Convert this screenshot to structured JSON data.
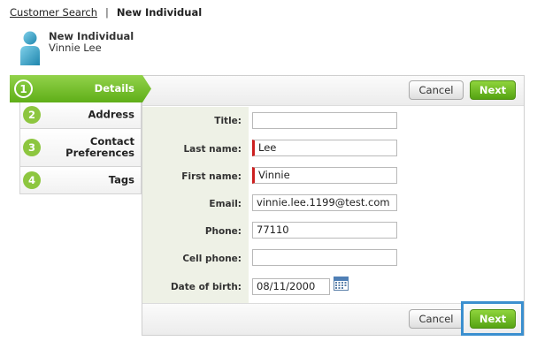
{
  "breadcrumb": {
    "link": "Customer Search",
    "separator": "|",
    "current": "New Individual"
  },
  "header": {
    "record_type": "New Individual",
    "name": "Vinnie Lee",
    "icon": "person-icon"
  },
  "steps": [
    {
      "number": "1",
      "label": "Details",
      "active": true
    },
    {
      "number": "2",
      "label": "Address",
      "active": false
    },
    {
      "number": "3",
      "label": "Contact\nPreferences",
      "active": false
    },
    {
      "number": "4",
      "label": "Tags",
      "active": false
    }
  ],
  "toolbar": {
    "cancel_label": "Cancel",
    "next_label": "Next"
  },
  "form": {
    "title_label": "Title:",
    "title_value": "",
    "last_name_label": "Last name:",
    "last_name_value": "Lee",
    "first_name_label": "First name:",
    "first_name_value": "Vinnie",
    "email_label": "Email:",
    "email_value": "vinnie.lee.1199@test.com",
    "phone_label": "Phone:",
    "phone_value": "77110",
    "cell_label": "Cell phone:",
    "cell_value": "",
    "dob_label": "Date of birth:",
    "dob_value": "08/11/2000"
  },
  "colors": {
    "accent_green": "#6dbb1f",
    "required_marker": "#cc1f1f",
    "focus_outline": "#3b8fcf"
  }
}
